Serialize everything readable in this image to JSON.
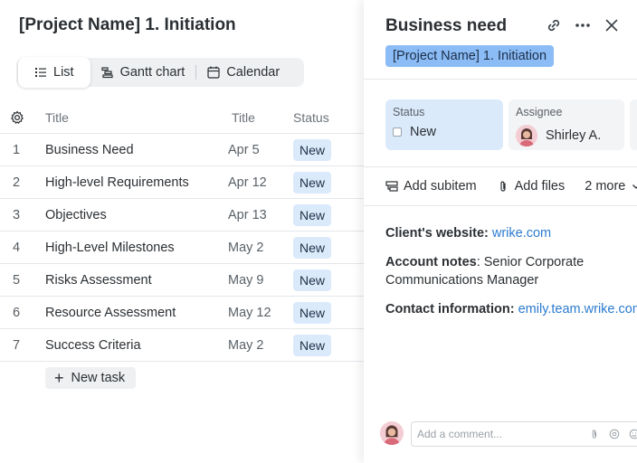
{
  "project": {
    "title": "[Project Name] 1. Initiation"
  },
  "views": [
    {
      "label": "List",
      "icon": "list-icon",
      "active": true
    },
    {
      "label": "Gantt chart",
      "icon": "gantt-icon",
      "active": false
    },
    {
      "label": "Calendar",
      "icon": "calendar-icon",
      "active": false
    }
  ],
  "table": {
    "columns": [
      "Title",
      "Title",
      "Status"
    ],
    "rows": [
      {
        "num": "1",
        "title": "Business Need",
        "date": "Apr 5",
        "status": "New"
      },
      {
        "num": "2",
        "title": "High-level Requirements",
        "date": "Apr 12",
        "status": "New"
      },
      {
        "num": "3",
        "title": "Objectives",
        "date": "Apr 13",
        "status": "New"
      },
      {
        "num": "4",
        "title": "High-Level Milestones",
        "date": "May 2",
        "status": "New"
      },
      {
        "num": "5",
        "title": "Risks Assessment",
        "date": "May 9",
        "status": "New"
      },
      {
        "num": "6",
        "title": "Resource Assessment",
        "date": "May 12",
        "status": "New"
      },
      {
        "num": "7",
        "title": "Success Criteria",
        "date": "May 2",
        "status": "New"
      }
    ],
    "new_task_label": "New task"
  },
  "task": {
    "title": "Business need",
    "project_chip": "[Project Name] 1. Initiation",
    "status_label": "Status",
    "status_value": "New",
    "assignee_label": "Assignee",
    "assignee_value": "Shirley A.",
    "actions": {
      "add_subitem": "Add subitem",
      "add_files": "Add files",
      "more": "2 more"
    },
    "description": {
      "website_label": "Client's website:",
      "website_value": "wrike.com",
      "notes_label": "Account notes",
      "notes_value": ": Senior Corporate Communications Manager",
      "contact_label": "Contact information:",
      "contact_value": "emily.team.wrike.com"
    },
    "comment_placeholder": "Add a comment..."
  },
  "colors": {
    "accent": "#2b7bd0",
    "status_bg": "#dbeafb",
    "chip_bg": "#8bbcf6"
  }
}
